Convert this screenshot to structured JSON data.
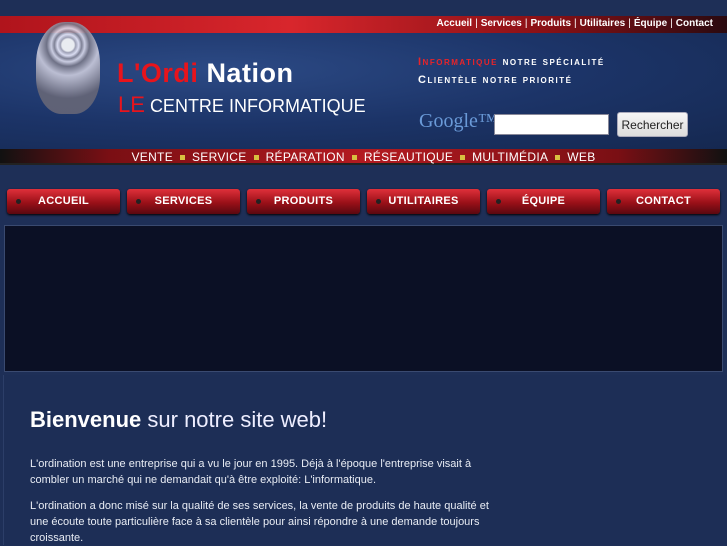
{
  "top_links": [
    "Accueil",
    "Services",
    "Produits",
    "Utilitaires",
    "Équipe",
    "Contact"
  ],
  "logo": {
    "title_a": "L'Ordi",
    "title_b": "Nation",
    "sub_a": "LE",
    "sub_b": "CENTRE INFORMATIQUE"
  },
  "slogans": {
    "line1_a": "Informatique",
    "line1_b": "notre spécialité",
    "line2": "Clientèle notre priorité"
  },
  "search": {
    "brand": "Google™",
    "value": "",
    "button": "Rechercher"
  },
  "strip": [
    "VENTE",
    "SERVICE",
    "RÉPARATION",
    "RÉSEAUTIQUE",
    "MULTIMÉDIA",
    "WEB"
  ],
  "nav": [
    "ACCUEIL",
    "SERVICES",
    "PRODUITS",
    "UTILITAIRES",
    "ÉQUIPE",
    "CONTACT"
  ],
  "content": {
    "welcome_bold": "Bienvenue",
    "welcome_rest": "sur notre site web!",
    "p1": "L'ordination est une entreprise qui a vu le jour en 1995. Déjà à l'époque l'entreprise visait à combler un marché qui ne demandait qu'à être exploité: L'informatique.",
    "p2": "L'ordination a donc misé sur la qualité de ses services, la vente de produits de haute qualité et une écoute toute particulière face à sa clientèle pour ainsi répondre à une demande toujours croissante."
  }
}
